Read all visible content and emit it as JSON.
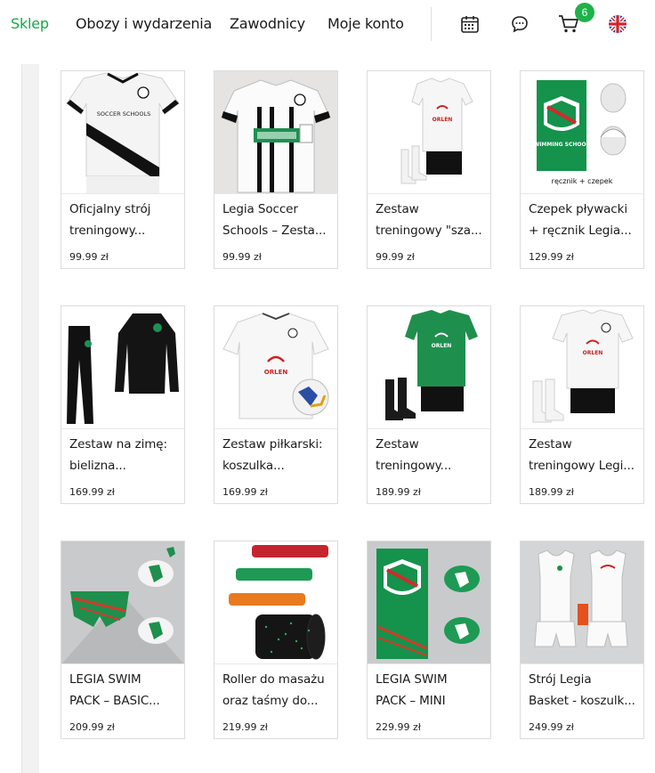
{
  "nav": {
    "links": [
      {
        "label": "Sklep",
        "active": true
      },
      {
        "label": "Obozy i wydarzenia",
        "active": false
      },
      {
        "label": "Zawodnicy",
        "active": false
      },
      {
        "label": "Moje konto",
        "active": false
      }
    ],
    "icons": [
      "calendar-icon",
      "chat-icon",
      "cart-icon",
      "uk-flag-icon"
    ],
    "cart_count": "6"
  },
  "colors": {
    "accent": "#15a84a",
    "badge": "#1fb24a"
  },
  "products": [
    {
      "title": "Oficjalny strój\ntreningowy...",
      "price": "99.99 zł"
    },
    {
      "title": "Legia Soccer\nSchools – Zesta...",
      "price": "99.99 zł"
    },
    {
      "title": "Zestaw\ntreningowy \"sza...",
      "price": "99.99 zł"
    },
    {
      "title": "Czepek pływacki\n+ ręcznik Legia...",
      "price": "129.99 zł"
    },
    {
      "title": "Zestaw na zimę:\nbielizna...",
      "price": "169.99 zł"
    },
    {
      "title": "Zestaw piłkarski:\nkoszulka...",
      "price": "169.99 zł"
    },
    {
      "title": "Zestaw\ntreningowy...",
      "price": "189.99 zł"
    },
    {
      "title": "Zestaw\ntreningowy Legi...",
      "price": "189.99 zł"
    },
    {
      "title": "LEGIA SWIM\nPACK – BASIC...",
      "price": "209.99 zł"
    },
    {
      "title": "Roller do masażu\noraz taśmy do...",
      "price": "219.99 zł"
    },
    {
      "title": "LEGIA SWIM\nPACK – MINI",
      "price": "229.99 zł"
    },
    {
      "title": "Strój Legia\nBasket - koszulk...",
      "price": "249.99 zł"
    }
  ],
  "image_text": {
    "shirt1": "SOCCER SCHOOLS",
    "towel": "SWIMMING SCHOOLS",
    "towel_caption": "ręcznik + czepek",
    "sponsor": "ORLEN"
  }
}
